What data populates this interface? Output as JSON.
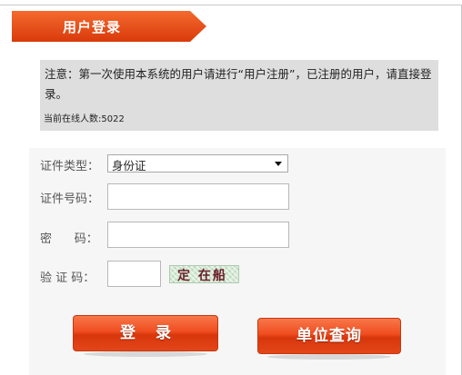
{
  "header": {
    "title": "用户登录"
  },
  "notice": {
    "text": "注意：第一次使用本系统的用户请进行“用户注册”，已注册的用户，请直接登录。",
    "online_label": "当前在线人数:",
    "online_count": "5022"
  },
  "form": {
    "id_type_label": "证件类型：",
    "id_type_value": "身份证",
    "id_number_label": "证件号码：",
    "password_label": "密      码：",
    "captcha_label": "验 证 码：",
    "captcha_text": "定 在船"
  },
  "buttons": {
    "login": "登录",
    "unit_query": "单位查询"
  },
  "colors": {
    "accent": "#ef4d1f",
    "ribbon": "#e2460f"
  }
}
